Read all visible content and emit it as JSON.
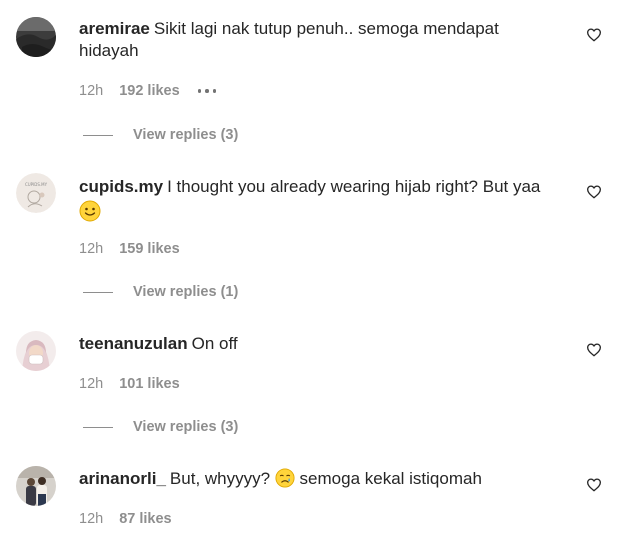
{
  "comments": [
    {
      "username": "aremirae",
      "text": "Sikit lagi nak tutup penuh.. semoga mendapat hidayah",
      "time": "12h",
      "likes": "192 likes",
      "replies": "View replies (3)"
    },
    {
      "username": "cupids.my",
      "text": "I thought you already wearing hijab right? But yaa",
      "emoji": "slightly-smiling-face",
      "time": "12h",
      "likes": "159 likes",
      "replies": "View replies (1)"
    },
    {
      "username": "teenanuzulan",
      "text": "On off",
      "time": "12h",
      "likes": "101 likes",
      "replies": "View replies (3)"
    },
    {
      "username": "arinanorli_",
      "text_before": "But, whyyyy?",
      "emoji": "crying-face",
      "text_after": "semoga kekal istiqomah",
      "time": "12h",
      "likes": "87 likes"
    }
  ],
  "icons": {
    "like": "heart-outline-icon",
    "more": "more-options-icon"
  }
}
